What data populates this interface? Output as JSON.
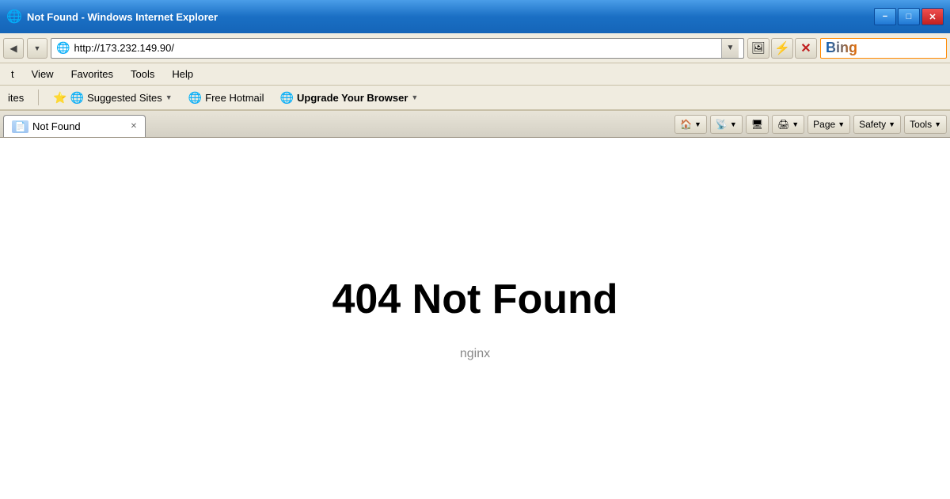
{
  "title_bar": {
    "title": "Not Found - Windows Internet Explorer",
    "icon": "🌐",
    "min_label": "−",
    "max_label": "□",
    "close_label": "✕"
  },
  "address_bar": {
    "url": "http://173.232.149.90/",
    "ie_icon": "🌐",
    "refresh_icon": "⚡",
    "stop_icon": "✕",
    "dropdown_arrow": "▼",
    "image_icon": "🖼",
    "bing_label": "Bing",
    "bing_icon": "b"
  },
  "menu": {
    "items": [
      "t",
      "View",
      "Favorites",
      "Tools",
      "Help"
    ]
  },
  "favorites_bar": {
    "items_label": "ites",
    "suggested_sites": "Suggested Sites",
    "free_hotmail": "Free Hotmail",
    "upgrade_browser": "Upgrade Your Browser"
  },
  "tab_bar": {
    "tab_label": "Not Found",
    "toolbar_buttons": [
      "🏠",
      "📡",
      "🖥",
      "🖨",
      "Page",
      "Safety",
      "Tools"
    ]
  },
  "page": {
    "error_heading": "404 Not Found",
    "server_label": "nginx"
  }
}
